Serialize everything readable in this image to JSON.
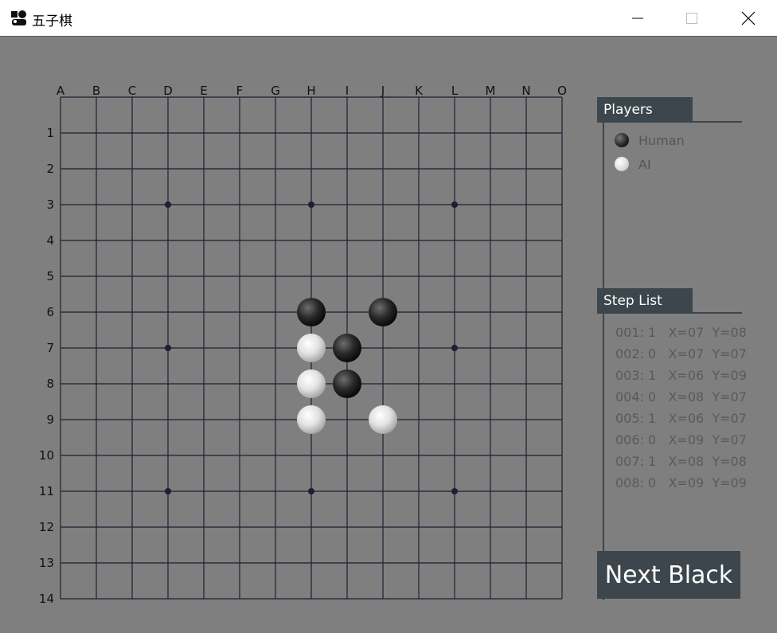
{
  "window": {
    "title": "五子棋",
    "controls": [
      "minimize-icon",
      "maximize-icon",
      "close-icon"
    ]
  },
  "board": {
    "columns": [
      "A",
      "B",
      "C",
      "D",
      "E",
      "F",
      "G",
      "H",
      "I",
      "J",
      "K",
      "L",
      "M",
      "N",
      "O"
    ],
    "rows": [
      "1",
      "2",
      "3",
      "4",
      "5",
      "6",
      "7",
      "8",
      "9",
      "10",
      "11",
      "12",
      "13",
      "14"
    ],
    "star_points": [
      [
        "D",
        "3"
      ],
      [
        "H",
        "3"
      ],
      [
        "L",
        "3"
      ],
      [
        "D",
        "7"
      ],
      [
        "L",
        "7"
      ],
      [
        "D",
        "11"
      ],
      [
        "H",
        "11"
      ],
      [
        "L",
        "11"
      ]
    ],
    "stones": [
      {
        "col": "H",
        "row": "6",
        "color": "black"
      },
      {
        "col": "J",
        "row": "6",
        "color": "black"
      },
      {
        "col": "H",
        "row": "7",
        "color": "white"
      },
      {
        "col": "I",
        "row": "7",
        "color": "black"
      },
      {
        "col": "H",
        "row": "8",
        "color": "white"
      },
      {
        "col": "I",
        "row": "8",
        "color": "black"
      },
      {
        "col": "H",
        "row": "9",
        "color": "white"
      },
      {
        "col": "J",
        "row": "9",
        "color": "white"
      }
    ],
    "colors": {
      "line": "#1f1f33",
      "background": "#7f7f7f"
    }
  },
  "players_panel": {
    "title": "Players",
    "players": [
      {
        "name": "Human",
        "stone": "black"
      },
      {
        "name": "AI",
        "stone": "white"
      }
    ]
  },
  "steps_panel": {
    "title": "Step List",
    "steps": [
      "001: 1   X=07  Y=08",
      "002: 0   X=07  Y=07",
      "003: 1   X=06  Y=09",
      "004: 0   X=08  Y=07",
      "005: 1   X=06  Y=07",
      "006: 0   X=09  Y=07",
      "007: 1   X=08  Y=08",
      "008: 0   X=09  Y=09"
    ]
  },
  "next_button": {
    "label": "Next Black"
  },
  "accent_color": "#3c464c"
}
